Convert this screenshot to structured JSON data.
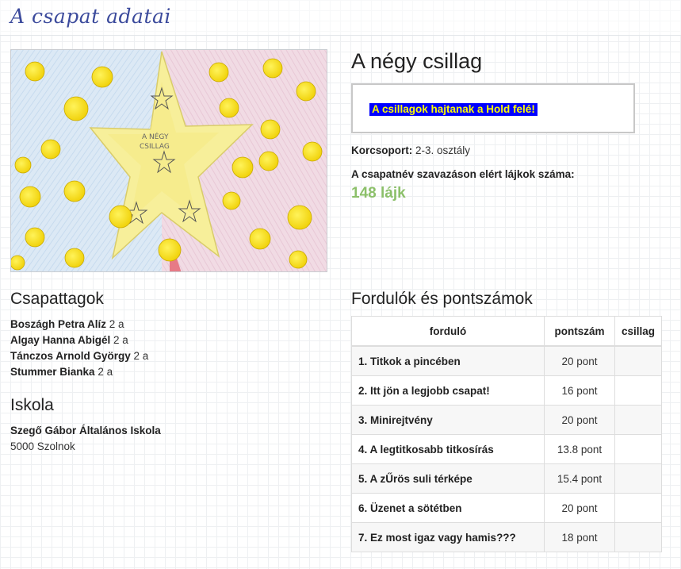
{
  "page": {
    "title": "A csapat adatai"
  },
  "team": {
    "name": "A négy csillag",
    "motto": "A csillagok hajtanak a Hold felé!",
    "age_group_label": "Korcsoport:",
    "age_group_value": "2-3. osztály",
    "likes_label": "A csapatnév szavazáson elért lájkok száma:",
    "likes_value": "148 lájk",
    "drawing_text_line1": "A NÉGY",
    "drawing_text_line2": "CSILLAG"
  },
  "members": {
    "heading": "Csapattagok",
    "items": [
      {
        "name": "Boszágh Petra Alíz",
        "grade": "2 a"
      },
      {
        "name": "Algay Hanna Abigél",
        "grade": "2 a"
      },
      {
        "name": "Tánczos Arnold György",
        "grade": "2 a"
      },
      {
        "name": "Stummer Bianka",
        "grade": "2 a"
      }
    ]
  },
  "school": {
    "heading": "Iskola",
    "name": "Szegő Gábor Általános Iskola",
    "address": "5000 Szolnok"
  },
  "rounds": {
    "heading": "Fordulók és pontszámok",
    "columns": [
      "forduló",
      "pontszám",
      "csillag"
    ],
    "rows": [
      {
        "name": "1. Titkok a pincében",
        "points": "20 pont",
        "star": ""
      },
      {
        "name": "2. Itt jön a legjobb csapat!",
        "points": "16 pont",
        "star": ""
      },
      {
        "name": "3. Minirejtvény",
        "points": "20 pont",
        "star": ""
      },
      {
        "name": "4. A legtitkosabb titkosírás",
        "points": "13.8 pont",
        "star": ""
      },
      {
        "name": "5. A zŰrös suli térképe",
        "points": "15.4 pont",
        "star": ""
      },
      {
        "name": "6. Üzenet a sötétben",
        "points": "20 pont",
        "star": ""
      },
      {
        "name": "7. Ez most igaz vagy hamis???",
        "points": "18 pont",
        "star": ""
      }
    ]
  },
  "colors": {
    "title": "#3b4a9c",
    "likes": "#8cc06a",
    "motto_bg": "#0000ff",
    "motto_text": "#ffff00"
  }
}
